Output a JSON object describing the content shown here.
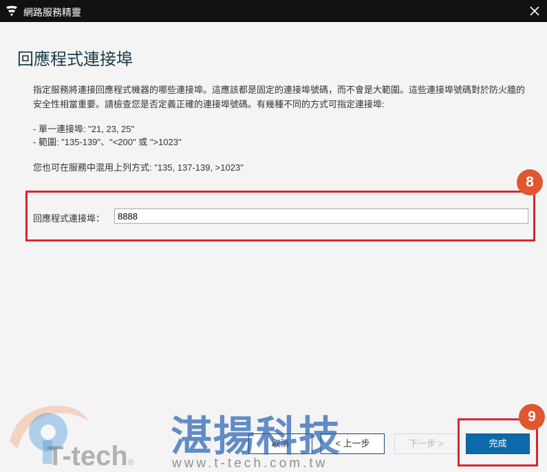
{
  "window": {
    "title": "網路服務精靈"
  },
  "page": {
    "heading": "回應程式連接埠",
    "description": "指定服務將連接回應程式機器的哪些連接埠。這應該都是固定的連接埠號碼，而不會是大範圍。這些連接埠號碼對於防火牆的安全性相當重要。請檢查您是否定義正確的連接埠號碼。有幾種不同的方式可指定連接埠:",
    "example_single": "- 單一連接埠: \"21, 23, 25\"",
    "example_range": "- 範圍: \"135-139\"、\"<200\" 或 \">1023\"",
    "mixed_hint": "您也可在服務中混用上列方式: \"135, 137-139, >1023\"",
    "port_label": "回應程式連接埠：",
    "port_value": "8888"
  },
  "annotations": {
    "step_a": "8",
    "step_b": "9"
  },
  "buttons": {
    "cancel": "取消",
    "back": "< 上一步",
    "next": "下一步 >",
    "finish": "完成"
  },
  "watermark": {
    "brand": "湛揚科技",
    "url": "www.t-tech.com.tw",
    "logo_text": "T-tech",
    "registered": "®"
  },
  "colors": {
    "titlebar": "#111111",
    "accent": "#0d6aaa",
    "highlight": "#d7262f",
    "badge": "#e0572f"
  },
  "icons": {
    "app": "fsecure-logo-icon",
    "close": "close-icon"
  }
}
